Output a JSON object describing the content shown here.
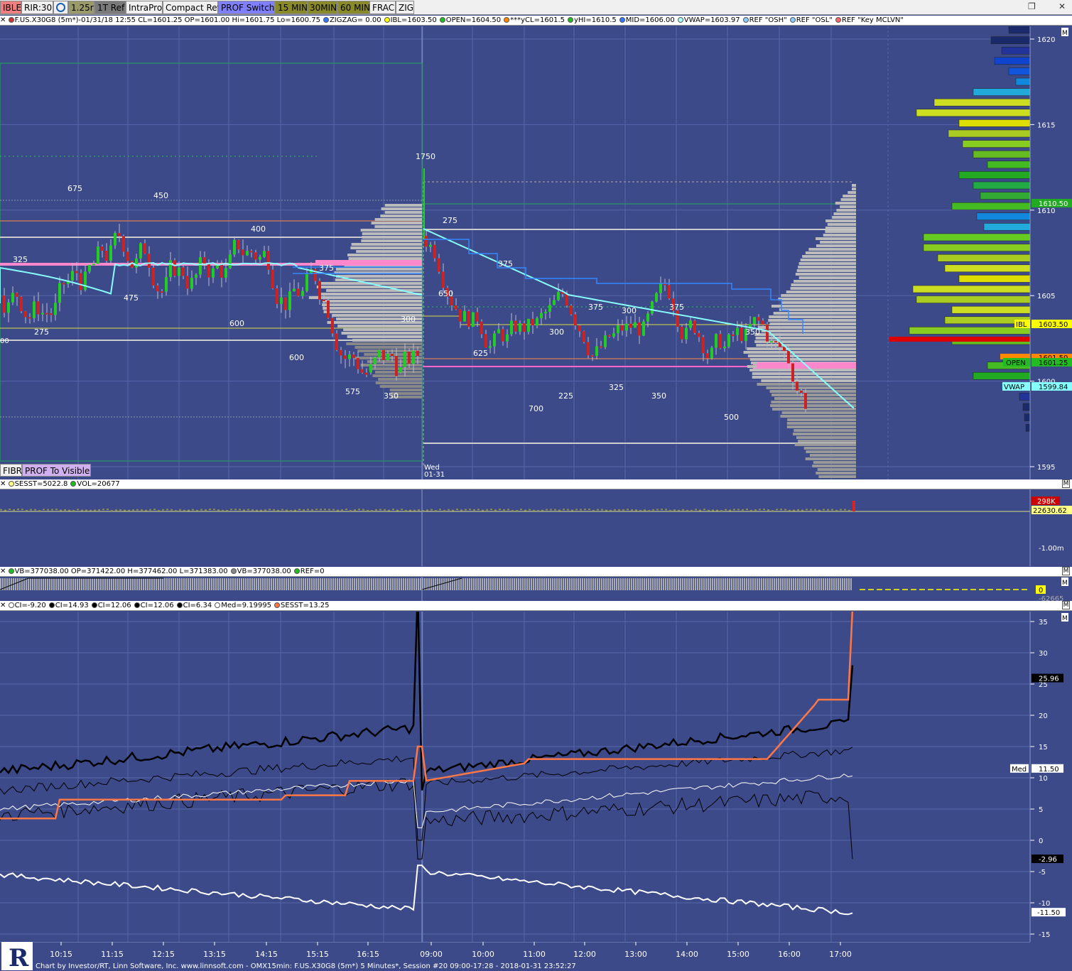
{
  "toolbar": {
    "buttons": [
      {
        "label": "IBLE",
        "bg": "#f08080"
      },
      {
        "label": "RIR:30",
        "bg": "#f0f0f0"
      },
      {
        "label": "",
        "bg": "#f0f0f0",
        "icon": "clock-icon"
      },
      {
        "label": "1.25r",
        "bg": "#9a9a6a"
      },
      {
        "label": "1T Ref",
        "bg": "#7a7a7a"
      },
      {
        "label": "IntraPro",
        "bg": "#f0f0f0"
      },
      {
        "label": "Compact Ref",
        "bg": "#f0f0f0"
      },
      {
        "label": "PROF Switch",
        "bg": "#8080ff"
      },
      {
        "label": "15 MIN",
        "bg": "#8a8a2a"
      },
      {
        "label": "30MIN",
        "bg": "#8a8a2a"
      },
      {
        "label": "60 MIN",
        "bg": "#8a8a2a"
      },
      {
        "label": "FRAC",
        "bg": "#f0f0f0"
      },
      {
        "label": "ZIG",
        "bg": "#f0f0f0"
      }
    ],
    "restore_icon": "restore-icon",
    "close_icon": "close-icon"
  },
  "main_header": {
    "items": [
      {
        "text": "F.US.X30G8 (5m*)-01/31/18 12:55 CL=1601.25 OP=1601.00 Hi=1601.75 Lo=1600.75",
        "color": "#cc3333"
      },
      {
        "text": "ZIGZAG= 0.00",
        "color": "#3377ff"
      },
      {
        "text": "IBL=1603.50",
        "color": "#ffff00"
      },
      {
        "text": "OPEN=1604.50",
        "color": "#22bb22"
      },
      {
        "text": "***yCL=1601.5",
        "color": "#ff8800"
      },
      {
        "text": "yHI=1610.5",
        "color": "#22bb22"
      },
      {
        "text": "MID=1606.00",
        "color": "#3377ff"
      },
      {
        "text": "VWAP=1603.97",
        "color": "#aaffff"
      },
      {
        "text": "REF \"OSH\"",
        "color": "#88ccff"
      },
      {
        "text": "REF \"OSL\"",
        "color": "#88ccff"
      },
      {
        "text": "REF \"Key MCLVN\"",
        "color": "#ff6666"
      }
    ]
  },
  "price_axis": {
    "ticks": [
      "1620",
      "1615",
      "1610",
      "1605",
      "1600",
      "1595"
    ],
    "labels": {
      "ibl": "IBL",
      "ibl_val": "1603.50",
      "open": "OPEN",
      "open_val": "1601.25",
      "vwap": "VWAP",
      "vwap_val": "1599.84",
      "ycl_val": "1601.50",
      "yhi_val": "1610.50"
    }
  },
  "chart_annotations": {
    "volume_labels": [
      "675",
      "450",
      "400",
      "325",
      "475",
      "275",
      "600",
      "600",
      "575",
      "350",
      "300",
      "375",
      "1750",
      "275",
      "650",
      "375",
      "625",
      "300",
      "375",
      "300",
      "375",
      "350",
      "700",
      "225",
      "325",
      "350",
      "500"
    ],
    "date_label_day": "Wed",
    "date_label_date": "01-31"
  },
  "bottom_buttons": [
    {
      "label": "FIBR",
      "bg": "#f0f0f0"
    },
    {
      "label": "PROF To Visible",
      "bg": "#d0b0f0"
    }
  ],
  "volume_panel": {
    "header": [
      {
        "text": "SESST=5022.8",
        "color": "#ffff88"
      },
      {
        "text": "VOL=20677",
        "color": "#22bb22"
      }
    ],
    "labels": {
      "val_red": "298K",
      "val": "22630.62",
      "scale": "-1.00m"
    }
  },
  "vb_panel": {
    "header": [
      {
        "text": "VB=377038.00 OP=371422.00 H=377462.00 L=371383.00",
        "color": "#22bb22"
      },
      {
        "text": "VB=377038.00",
        "color": "#888888"
      },
      {
        "text": "REF=0",
        "color": "#22bb22"
      }
    ],
    "labels": {
      "zero": "0",
      "side": "-62665"
    }
  },
  "ci_panel": {
    "header": [
      {
        "text": "CI=-9.20",
        "color": "#ffffff"
      },
      {
        "text": "CI=14.93",
        "color": "#000000"
      },
      {
        "text": "CI=12.06",
        "color": "#000000"
      },
      {
        "text": "CI=12.06",
        "color": "#000000"
      },
      {
        "text": "CI=6.34",
        "color": "#000000"
      },
      {
        "text": "Med=9.19995",
        "color": "#ffffff"
      },
      {
        "text": "SESST=13.25",
        "color": "#ff7744"
      }
    ],
    "ticks": [
      "35",
      "30",
      "25",
      "20",
      "15",
      "10",
      "5",
      "0",
      "-5",
      "-10",
      "-15"
    ],
    "labels": {
      "v1": "25.96",
      "med": "Med",
      "med_val": "11.50",
      "v2": "-2.96",
      "v3": "-11.50"
    }
  },
  "time_axis": {
    "ticks": [
      "10:15",
      "11:15",
      "12:15",
      "13:15",
      "14:15",
      "15:15",
      "16:15",
      "09:00",
      "10:00",
      "11:00",
      "12:00",
      "13:00",
      "14:00",
      "15:00",
      "16:00",
      "17:00"
    ]
  },
  "status_bar": "Chart by Investor/RT, Linn Software, Inc. www.linnsoft.com - OMX15min: F.US.X30G8 (5m*) 5 Minutes*, Session #20 09:00-17:28 - 2018-01-31 23:52:27"
}
